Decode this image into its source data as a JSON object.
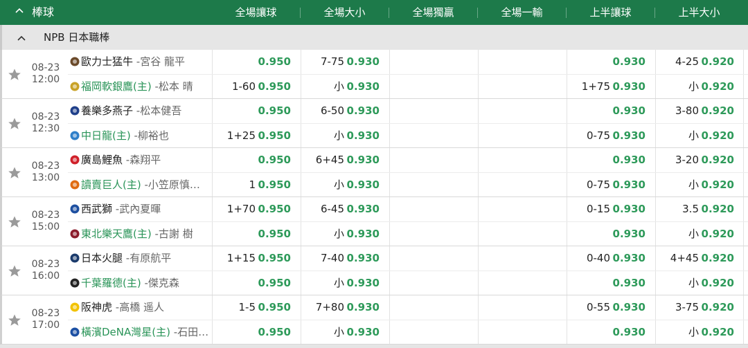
{
  "header": {
    "sport_label": "棒球",
    "columns": [
      "全場讓球",
      "全場大小",
      "全場獨贏",
      "全場一輸",
      "上半讓球",
      "上半大小"
    ]
  },
  "league": {
    "name": "NPB 日本職棒"
  },
  "matches": [
    {
      "date": "08-23",
      "time": "12:00",
      "team1": {
        "name": "歐力士猛牛",
        "pitcher": "-宮谷 龍平",
        "home": false,
        "logo_color": "#6b4a2a"
      },
      "team2": {
        "name": "福岡軟銀鷹(主)",
        "pitcher": "-松本 晴",
        "home": true,
        "logo_color": "#c9a227"
      },
      "row1": {
        "fh_hc": "",
        "fh_odds": "0.950",
        "fou_line": "7-75",
        "fou_odds": "0.930",
        "hh_hc": "",
        "hh_odds": "0.930",
        "hou_line": "4-25",
        "hou_odds": "0.920"
      },
      "row2": {
        "fh_hc": "1-60",
        "fh_odds": "0.950",
        "fou_line": "小",
        "fou_odds": "0.930",
        "hh_hc": "1+75",
        "hh_odds": "0.930",
        "hou_line": "小",
        "hou_odds": "0.920"
      }
    },
    {
      "date": "08-23",
      "time": "12:30",
      "team1": {
        "name": "養樂多燕子",
        "pitcher": "-松本健吾",
        "home": false,
        "logo_color": "#1f3f8a"
      },
      "team2": {
        "name": "中日龍(主)",
        "pitcher": "-柳裕也",
        "home": true,
        "logo_color": "#2f7fc9"
      },
      "row1": {
        "fh_hc": "",
        "fh_odds": "0.950",
        "fou_line": "6-50",
        "fou_odds": "0.930",
        "hh_hc": "",
        "hh_odds": "0.930",
        "hou_line": "3-80",
        "hou_odds": "0.920"
      },
      "row2": {
        "fh_hc": "1+25",
        "fh_odds": "0.950",
        "fou_line": "小",
        "fou_odds": "0.930",
        "hh_hc": "0-75",
        "hh_odds": "0.930",
        "hou_line": "小",
        "hou_odds": "0.920"
      }
    },
    {
      "date": "08-23",
      "time": "13:00",
      "team1": {
        "name": "廣島鯉魚",
        "pitcher": "-森翔平",
        "home": false,
        "logo_color": "#d0202a"
      },
      "team2": {
        "name": "讀賣巨人(主)",
        "pitcher": "-小笠原慎…",
        "home": true,
        "logo_color": "#e06a10"
      },
      "row1": {
        "fh_hc": "",
        "fh_odds": "0.950",
        "fou_line": "6+45",
        "fou_odds": "0.930",
        "hh_hc": "",
        "hh_odds": "0.930",
        "hou_line": "3-20",
        "hou_odds": "0.920"
      },
      "row2": {
        "fh_hc": "1",
        "fh_odds": "0.950",
        "fou_line": "小",
        "fou_odds": "0.930",
        "hh_hc": "0-75",
        "hh_odds": "0.930",
        "hou_line": "小",
        "hou_odds": "0.920"
      }
    },
    {
      "date": "08-23",
      "time": "15:00",
      "team1": {
        "name": "西武獅",
        "pitcher": "-武內夏暉",
        "home": false,
        "logo_color": "#1d4fa0"
      },
      "team2": {
        "name": "東北樂天鷹(主)",
        "pitcher": "-古謝 樹",
        "home": true,
        "logo_color": "#8a1c2b"
      },
      "row1": {
        "fh_hc": "1+70",
        "fh_odds": "0.950",
        "fou_line": "6-45",
        "fou_odds": "0.930",
        "hh_hc": "0-15",
        "hh_odds": "0.930",
        "hou_line": "3.5",
        "hou_odds": "0.920"
      },
      "row2": {
        "fh_hc": "",
        "fh_odds": "0.950",
        "fou_line": "小",
        "fou_odds": "0.930",
        "hh_hc": "",
        "hh_odds": "0.930",
        "hou_line": "小",
        "hou_odds": "0.920"
      }
    },
    {
      "date": "08-23",
      "time": "16:00",
      "team1": {
        "name": "日本火腿",
        "pitcher": "-有原航平",
        "home": false,
        "logo_color": "#1a3a6b"
      },
      "team2": {
        "name": "千葉羅德(主)",
        "pitcher": "-傑克森",
        "home": true,
        "logo_color": "#222222"
      },
      "row1": {
        "fh_hc": "1+15",
        "fh_odds": "0.950",
        "fou_line": "7-40",
        "fou_odds": "0.930",
        "hh_hc": "0-40",
        "hh_odds": "0.930",
        "hou_line": "4+45",
        "hou_odds": "0.920"
      },
      "row2": {
        "fh_hc": "",
        "fh_odds": "0.950",
        "fou_line": "小",
        "fou_odds": "0.930",
        "hh_hc": "",
        "hh_odds": "0.930",
        "hou_line": "小",
        "hou_odds": "0.920"
      }
    },
    {
      "date": "08-23",
      "time": "17:00",
      "team1": {
        "name": "阪神虎",
        "pitcher": "-高橋 遥人",
        "home": false,
        "logo_color": "#f2c200"
      },
      "team2": {
        "name": "橫濱DeNA灣星(主)",
        "pitcher": "-石田…",
        "home": true,
        "logo_color": "#1b4fa3"
      },
      "row1": {
        "fh_hc": "1-5",
        "fh_odds": "0.950",
        "fou_line": "7+80",
        "fou_odds": "0.930",
        "hh_hc": "0-55",
        "hh_odds": "0.930",
        "hou_line": "3-75",
        "hou_odds": "0.920"
      },
      "row2": {
        "fh_hc": "",
        "fh_odds": "0.950",
        "fou_line": "小",
        "fou_odds": "0.930",
        "hh_hc": "",
        "hh_odds": "0.930",
        "hou_line": "小",
        "hou_odds": "0.920"
      }
    }
  ]
}
